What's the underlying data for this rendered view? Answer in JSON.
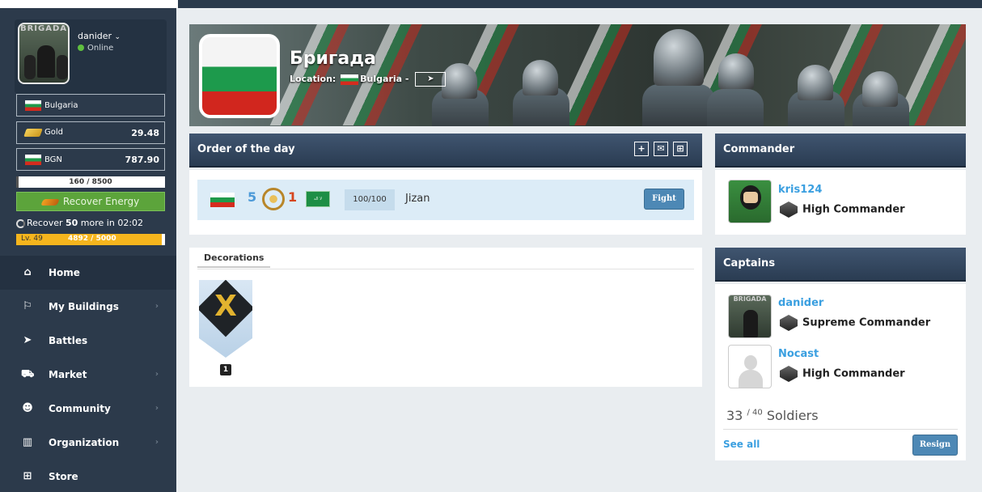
{
  "user": {
    "name": "danider",
    "status": "Online",
    "avatar_text": "BRIGADA"
  },
  "sidebar": {
    "country": "Bulgaria",
    "gold_label": "Gold",
    "gold_value": "29.48",
    "currency_label": "BGN",
    "currency_value": "787.90",
    "energy_text": "160 / 8500",
    "energy_fraction": 0.0188,
    "recover_label": "Recover Energy",
    "recover_timer_prefix": "Recover ",
    "recover_amount": "50",
    "recover_timer_suffix": " more in 02:02",
    "level_label": "Lv. 49",
    "xp_text": "4892 / 5000",
    "xp_fraction": 0.978,
    "nav": [
      {
        "label": "Home",
        "icon": "home-icon",
        "glyph": "⌂",
        "chevron": false
      },
      {
        "label": "My Buildings",
        "icon": "flag-icon",
        "glyph": "⚐",
        "chevron": true
      },
      {
        "label": "Battles",
        "icon": "send-icon",
        "glyph": "➤",
        "chevron": false
      },
      {
        "label": "Market",
        "icon": "cart-icon",
        "glyph": "⛟",
        "chevron": true
      },
      {
        "label": "Community",
        "icon": "users-icon",
        "glyph": "☻",
        "chevron": true
      },
      {
        "label": "Organization",
        "icon": "building-icon",
        "glyph": "▥",
        "chevron": true
      },
      {
        "label": "Store",
        "icon": "gift-icon",
        "glyph": "⊞",
        "chevron": false
      }
    ],
    "chevron_glyph": "›"
  },
  "group": {
    "name": "Бригада",
    "location_label": "Location:",
    "location_country": "Bulgaria",
    "location_sep": " -",
    "location_btn": "➤"
  },
  "order": {
    "title": "Order of the day",
    "icons": [
      {
        "name": "plus-icon",
        "glyph": "+"
      },
      {
        "name": "mail-icon",
        "glyph": "✉"
      },
      {
        "name": "gift-icon",
        "glyph": "⊞"
      }
    ],
    "score_left": "5",
    "score_right": "1",
    "saudi_text": "ﻻ اله",
    "count": "100/100",
    "region": "Jizan",
    "fight_label": "Fight"
  },
  "decorations": {
    "tab_label": "Decorations",
    "medal_letter": "X",
    "medal_count": "1"
  },
  "commander": {
    "title": "Commander",
    "name": "kris124",
    "rank": "High Commander"
  },
  "captains": {
    "title": "Captains",
    "list": [
      {
        "name": "danider",
        "rank": "Supreme Commander"
      },
      {
        "name": "Nocast",
        "rank": "High Commander"
      }
    ],
    "soldiers_count": "33",
    "soldiers_max": "/ 40",
    "soldiers_label": "Soldiers",
    "see_all": "See all",
    "resign_label": "Resign"
  }
}
